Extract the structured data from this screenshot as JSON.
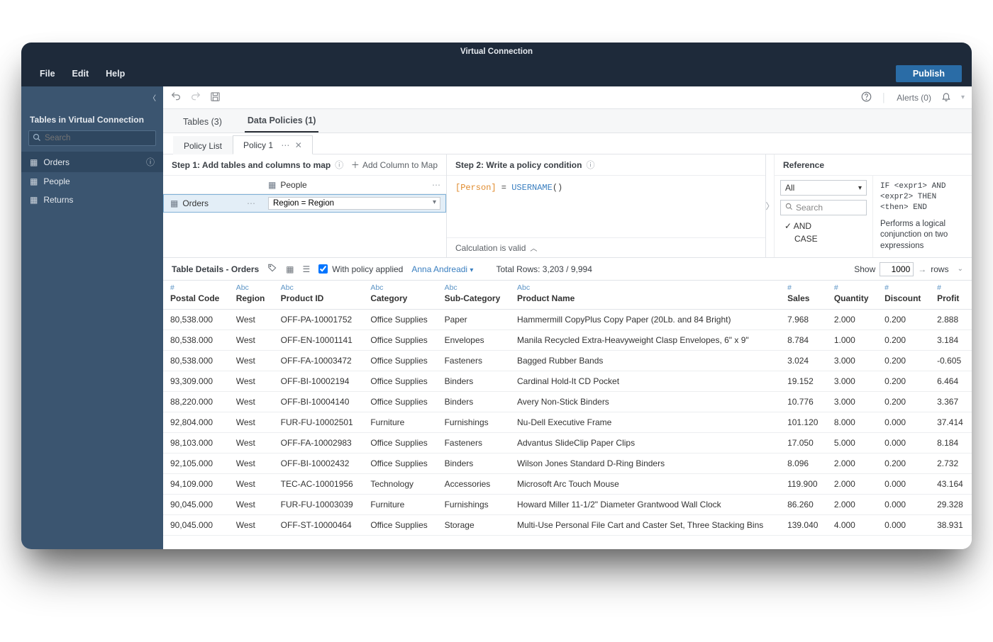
{
  "window_title": "Virtual Connection",
  "menu": {
    "file": "File",
    "edit": "Edit",
    "help": "Help"
  },
  "publish_label": "Publish",
  "toolbar": {
    "alerts": "Alerts (0)"
  },
  "sidebar": {
    "title": "Tables in Virtual Connection",
    "search_placeholder": "Search",
    "items": [
      {
        "label": "Orders",
        "selected": true,
        "info": true
      },
      {
        "label": "People",
        "selected": false,
        "info": false
      },
      {
        "label": "Returns",
        "selected": false,
        "info": false
      }
    ]
  },
  "primary_tabs": [
    {
      "label": "Tables (3)",
      "active": false
    },
    {
      "label": "Data Policies (1)",
      "active": true
    }
  ],
  "policy_subtabs": {
    "list_label": "Policy List",
    "policy_label": "Policy 1"
  },
  "step1": {
    "title": "Step 1: Add tables and columns to map",
    "add_col": "Add Column to Map",
    "people_label": "People",
    "orders_label": "Orders",
    "region_map": "Region = Region"
  },
  "step2": {
    "title": "Step 2: Write a policy condition",
    "field": "[Person]",
    "eq": " = ",
    "fn": "USERNAME",
    "paren": "()",
    "valid": "Calculation is valid"
  },
  "reference": {
    "title": "Reference",
    "filter": "All",
    "search_placeholder": "Search",
    "fn_and": "AND",
    "fn_case": "CASE",
    "syntax": "IF <expr1> AND <expr2> THEN <then> END",
    "desc": "Performs a logical conjunction on two expressions"
  },
  "details": {
    "title_prefix": "Table Details - ",
    "title_table": "Orders",
    "policy_applied": "With policy applied",
    "user": "Anna Andreadi",
    "total_rows": "Total Rows: 3,203 / 9,994",
    "show_label": "Show",
    "show_value": "1000",
    "rows_label": "rows"
  },
  "columns": [
    {
      "dtype": "#",
      "label": "Postal Code"
    },
    {
      "dtype": "Abc",
      "label": "Region"
    },
    {
      "dtype": "Abc",
      "label": "Product ID"
    },
    {
      "dtype": "Abc",
      "label": "Category"
    },
    {
      "dtype": "Abc",
      "label": "Sub-Category"
    },
    {
      "dtype": "Abc",
      "label": "Product Name"
    },
    {
      "dtype": "#",
      "label": "Sales"
    },
    {
      "dtype": "#",
      "label": "Quantity"
    },
    {
      "dtype": "#",
      "label": "Discount"
    },
    {
      "dtype": "#",
      "label": "Profit"
    }
  ],
  "rows": [
    [
      "80,538.000",
      "West",
      "OFF-PA-10001752",
      "Office Supplies",
      "Paper",
      "Hammermill CopyPlus Copy Paper (20Lb. and 84 Bright)",
      "7.968",
      "2.000",
      "0.200",
      "2.888"
    ],
    [
      "80,538.000",
      "West",
      "OFF-EN-10001141",
      "Office Supplies",
      "Envelopes",
      "Manila Recycled Extra-Heavyweight Clasp Envelopes, 6\" x 9\"",
      "8.784",
      "1.000",
      "0.200",
      "3.184"
    ],
    [
      "80,538.000",
      "West",
      "OFF-FA-10003472",
      "Office Supplies",
      "Fasteners",
      "Bagged Rubber Bands",
      "3.024",
      "3.000",
      "0.200",
      "-0.605"
    ],
    [
      "93,309.000",
      "West",
      "OFF-BI-10002194",
      "Office Supplies",
      "Binders",
      "Cardinal Hold-It CD Pocket",
      "19.152",
      "3.000",
      "0.200",
      "6.464"
    ],
    [
      "88,220.000",
      "West",
      "OFF-BI-10004140",
      "Office Supplies",
      "Binders",
      "Avery Non-Stick Binders",
      "10.776",
      "3.000",
      "0.200",
      "3.367"
    ],
    [
      "92,804.000",
      "West",
      "FUR-FU-10002501",
      "Furniture",
      "Furnishings",
      "Nu-Dell Executive Frame",
      "101.120",
      "8.000",
      "0.000",
      "37.414"
    ],
    [
      "98,103.000",
      "West",
      "OFF-FA-10002983",
      "Office Supplies",
      "Fasteners",
      "Advantus SlideClip Paper Clips",
      "17.050",
      "5.000",
      "0.000",
      "8.184"
    ],
    [
      "92,105.000",
      "West",
      "OFF-BI-10002432",
      "Office Supplies",
      "Binders",
      "Wilson Jones Standard D-Ring Binders",
      "8.096",
      "2.000",
      "0.200",
      "2.732"
    ],
    [
      "94,109.000",
      "West",
      "TEC-AC-10001956",
      "Technology",
      "Accessories",
      "Microsoft Arc Touch Mouse",
      "119.900",
      "2.000",
      "0.000",
      "43.164"
    ],
    [
      "90,045.000",
      "West",
      "FUR-FU-10003039",
      "Furniture",
      "Furnishings",
      "Howard Miller 11-1/2\" Diameter Grantwood Wall Clock",
      "86.260",
      "2.000",
      "0.000",
      "29.328"
    ],
    [
      "90,045.000",
      "West",
      "OFF-ST-10000464",
      "Office Supplies",
      "Storage",
      "Multi-Use Personal File Cart and Caster Set, Three Stacking Bins",
      "139.040",
      "4.000",
      "0.000",
      "38.931"
    ]
  ]
}
